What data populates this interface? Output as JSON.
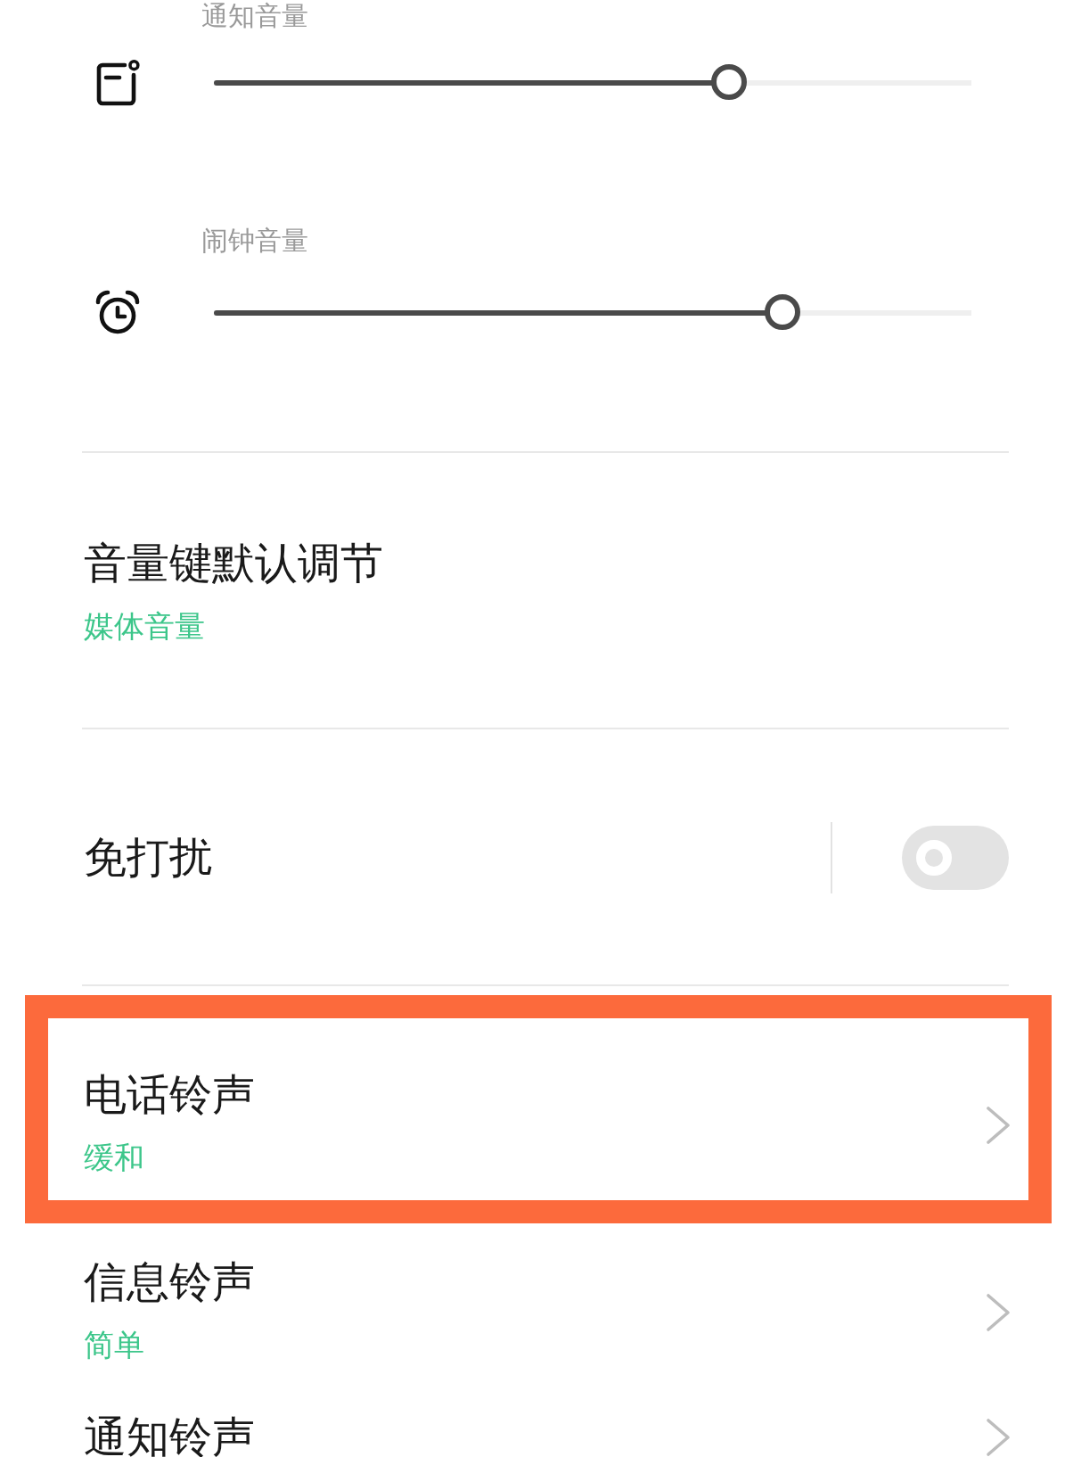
{
  "sliders": [
    {
      "kind": "notification",
      "label": "通知音量",
      "level": 0.68
    },
    {
      "kind": "alarm",
      "label": "闹钟音量",
      "level": 0.75
    }
  ],
  "settings": [
    {
      "kind": "select",
      "title": "音量键默认调节",
      "value": "媒体音量",
      "highlighted": false
    },
    {
      "kind": "toggle",
      "title": "免打扰",
      "on": false,
      "highlighted": false
    },
    {
      "kind": "link",
      "title": "电话铃声",
      "value": "缓和",
      "highlighted": true
    },
    {
      "kind": "link",
      "title": "信息铃声",
      "value": "简单",
      "highlighted": false
    },
    {
      "kind": "link",
      "title": "通知铃声",
      "highlighted": false
    }
  ]
}
